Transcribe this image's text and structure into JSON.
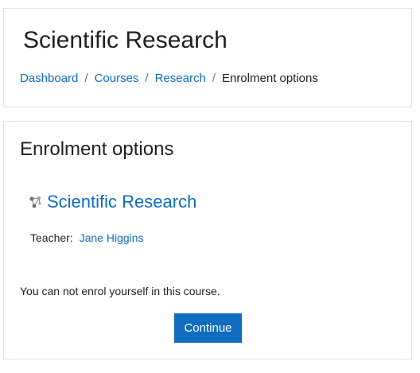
{
  "header": {
    "title": "Scientific Research",
    "breadcrumb": [
      {
        "label": "Dashboard"
      },
      {
        "label": "Courses"
      },
      {
        "label": "Research"
      },
      {
        "label": "Enrolment options"
      }
    ],
    "separator": "/"
  },
  "main": {
    "section_title": "Enrolment options",
    "course": {
      "icon": "course-network-icon",
      "name": "Scientific Research"
    },
    "teacher": {
      "label": "Teacher:",
      "name": "Jane Higgins"
    },
    "notice": "You can not enrol yourself in this course.",
    "continue_label": "Continue"
  },
  "colors": {
    "link": "#0f6cbf",
    "button_bg": "#0f6cbf",
    "button_text": "#ffffff",
    "border": "#dee2e6",
    "text": "#1d2125"
  }
}
